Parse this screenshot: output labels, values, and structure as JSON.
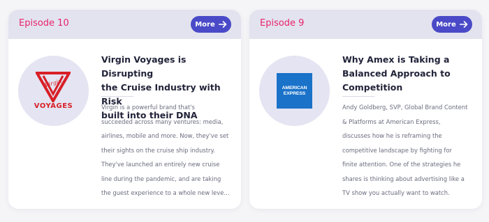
{
  "colors": {
    "page_bg": "#f5f5f8",
    "card_bg": "#ffffff",
    "header_bg": "#e3e3ef",
    "episode_accent": "#e8236a",
    "button_bg": "#4a4ac8",
    "virgin_red": "#d81f26",
    "amex_blue": "#1a72c9"
  },
  "episodes": [
    {
      "episode_label": "Episode 10",
      "more_label": "More",
      "more_icon": "arrow-right-icon",
      "logo": {
        "name": "virgin-voyages-logo",
        "brand_text": "VOYAGES",
        "script_text": "Virgin"
      },
      "title_lines": [
        "Virgin Voyages is Disrupting",
        "the Cruise Industry with Risk",
        "built into their DNA"
      ],
      "description_lines": [
        "Virgin is a powerful brand that's",
        "succeeded across many ventures: media,",
        "airlines, mobile and more. Now, they've set",
        "their sights on the cruise ship industry.",
        "They've launched an entirely new cruise",
        "line during the pandemic, and are taking",
        "the guest experience to a whole new leve…"
      ]
    },
    {
      "episode_label": "Episode 9",
      "more_label": "More",
      "more_icon": "arrow-right-icon",
      "logo": {
        "name": "american-express-logo",
        "line1": "AMERICAN",
        "line2": "EXPRESS"
      },
      "title_lines": [
        "Why Amex is Taking a",
        "Balanced Approach to",
        "Competition"
      ],
      "description_lines": [
        "Andy Goldberg, SVP, Global Brand Content",
        "& Platforms at American Express,",
        "discusses how he is reframing the",
        "competitive landscape by fighting for",
        "finite attention. One of the strategies he",
        "shares is thinking about advertising like a",
        "TV show you actually want to watch."
      ]
    }
  ]
}
